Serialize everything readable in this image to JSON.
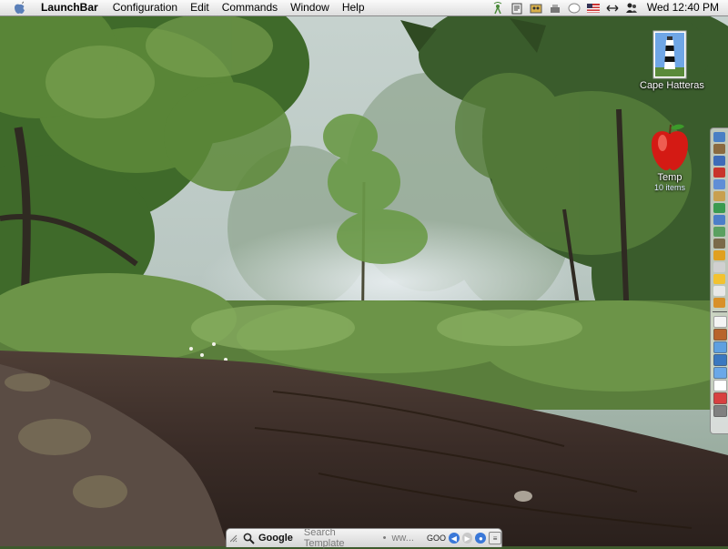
{
  "menubar": {
    "app_name": "LaunchBar",
    "menus": [
      "Configuration",
      "Edit",
      "Commands",
      "Window",
      "Help"
    ],
    "extras": [
      "radio-tower-icon",
      "script-icon",
      "finder-icon",
      "tools-icon",
      "chat-bubble-icon",
      "flag-us-icon",
      "network-arrows-icon",
      "user-icon"
    ],
    "clock": "Wed 12:40 PM"
  },
  "desktop": {
    "icons": [
      {
        "name": "lighthouse-photo-icon",
        "label": "Cape Hatteras",
        "sub": ""
      },
      {
        "name": "apple-folder-icon",
        "label": "Temp",
        "sub": "10 items"
      }
    ]
  },
  "dock": {
    "items_top": [
      "#4a7fc4",
      "#8a6a40",
      "#3e6bb8",
      "#c8342c",
      "#5f8ed6",
      "#c8a050",
      "#3a9a50",
      "#4c7ec8",
      "#5aa060",
      "#7a6a4a",
      "#e0a020",
      "#d0d0d0",
      "#f2c230",
      "#e8e8e8",
      "#d89028"
    ],
    "items_bottom": [
      "#f4f4f4",
      "#b8642c",
      "#5ea0e0",
      "#3a78c0",
      "#6aa8e8",
      "#ffffff",
      "#d84040",
      "#808080"
    ]
  },
  "searchbar": {
    "engine": "Google",
    "placeholder": "Search Template",
    "separator": "•",
    "tail": "ww...",
    "goo": "GOO"
  }
}
